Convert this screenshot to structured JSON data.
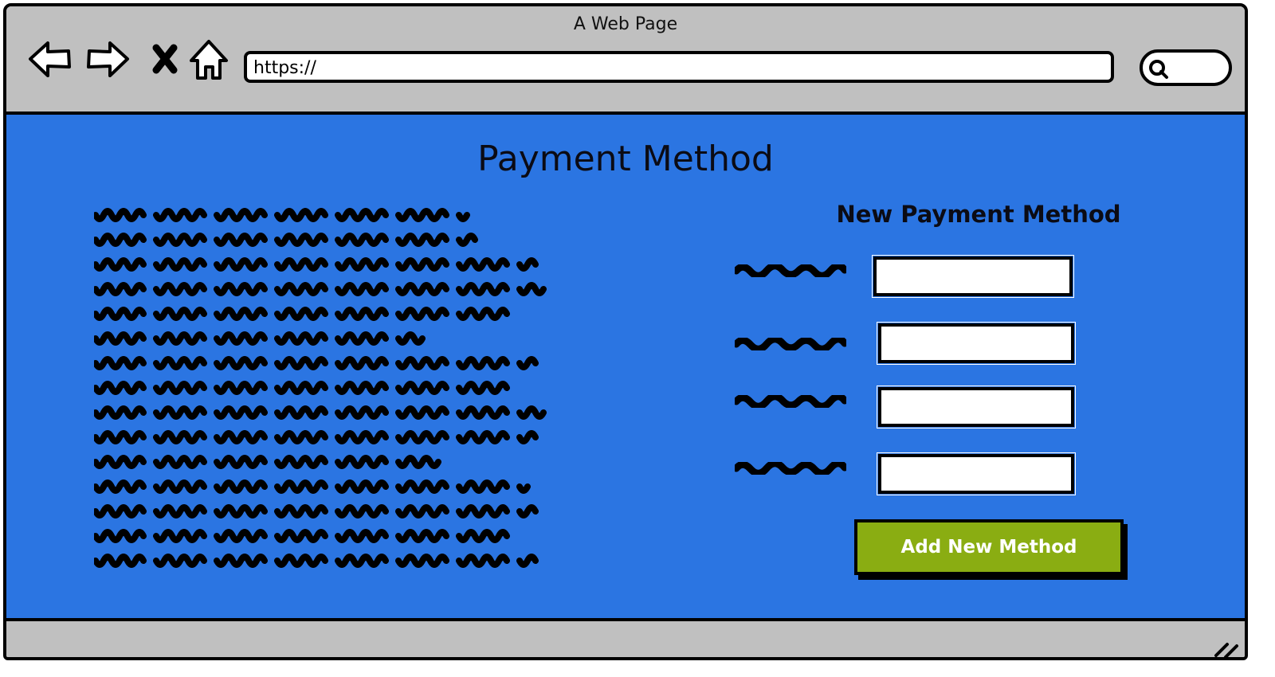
{
  "window": {
    "title": "A Web Page",
    "url": "https://",
    "nav_icons": [
      "back-arrow-icon",
      "forward-arrow-icon",
      "close-x-icon",
      "home-icon"
    ],
    "search_icon": "magnifier-icon"
  },
  "page": {
    "title": "Payment Method",
    "body_text_lines": 15
  },
  "form": {
    "heading": "New Payment Method",
    "fields": [
      {
        "value": ""
      },
      {
        "value": ""
      },
      {
        "value": ""
      },
      {
        "value": ""
      }
    ],
    "submit_label": "Add New Method"
  },
  "colors": {
    "content_background": "#2b75e2",
    "chrome_background": "#c0c0c0",
    "button_background": "#8aad12",
    "button_text": "#ffffff",
    "ink": "#000000"
  }
}
